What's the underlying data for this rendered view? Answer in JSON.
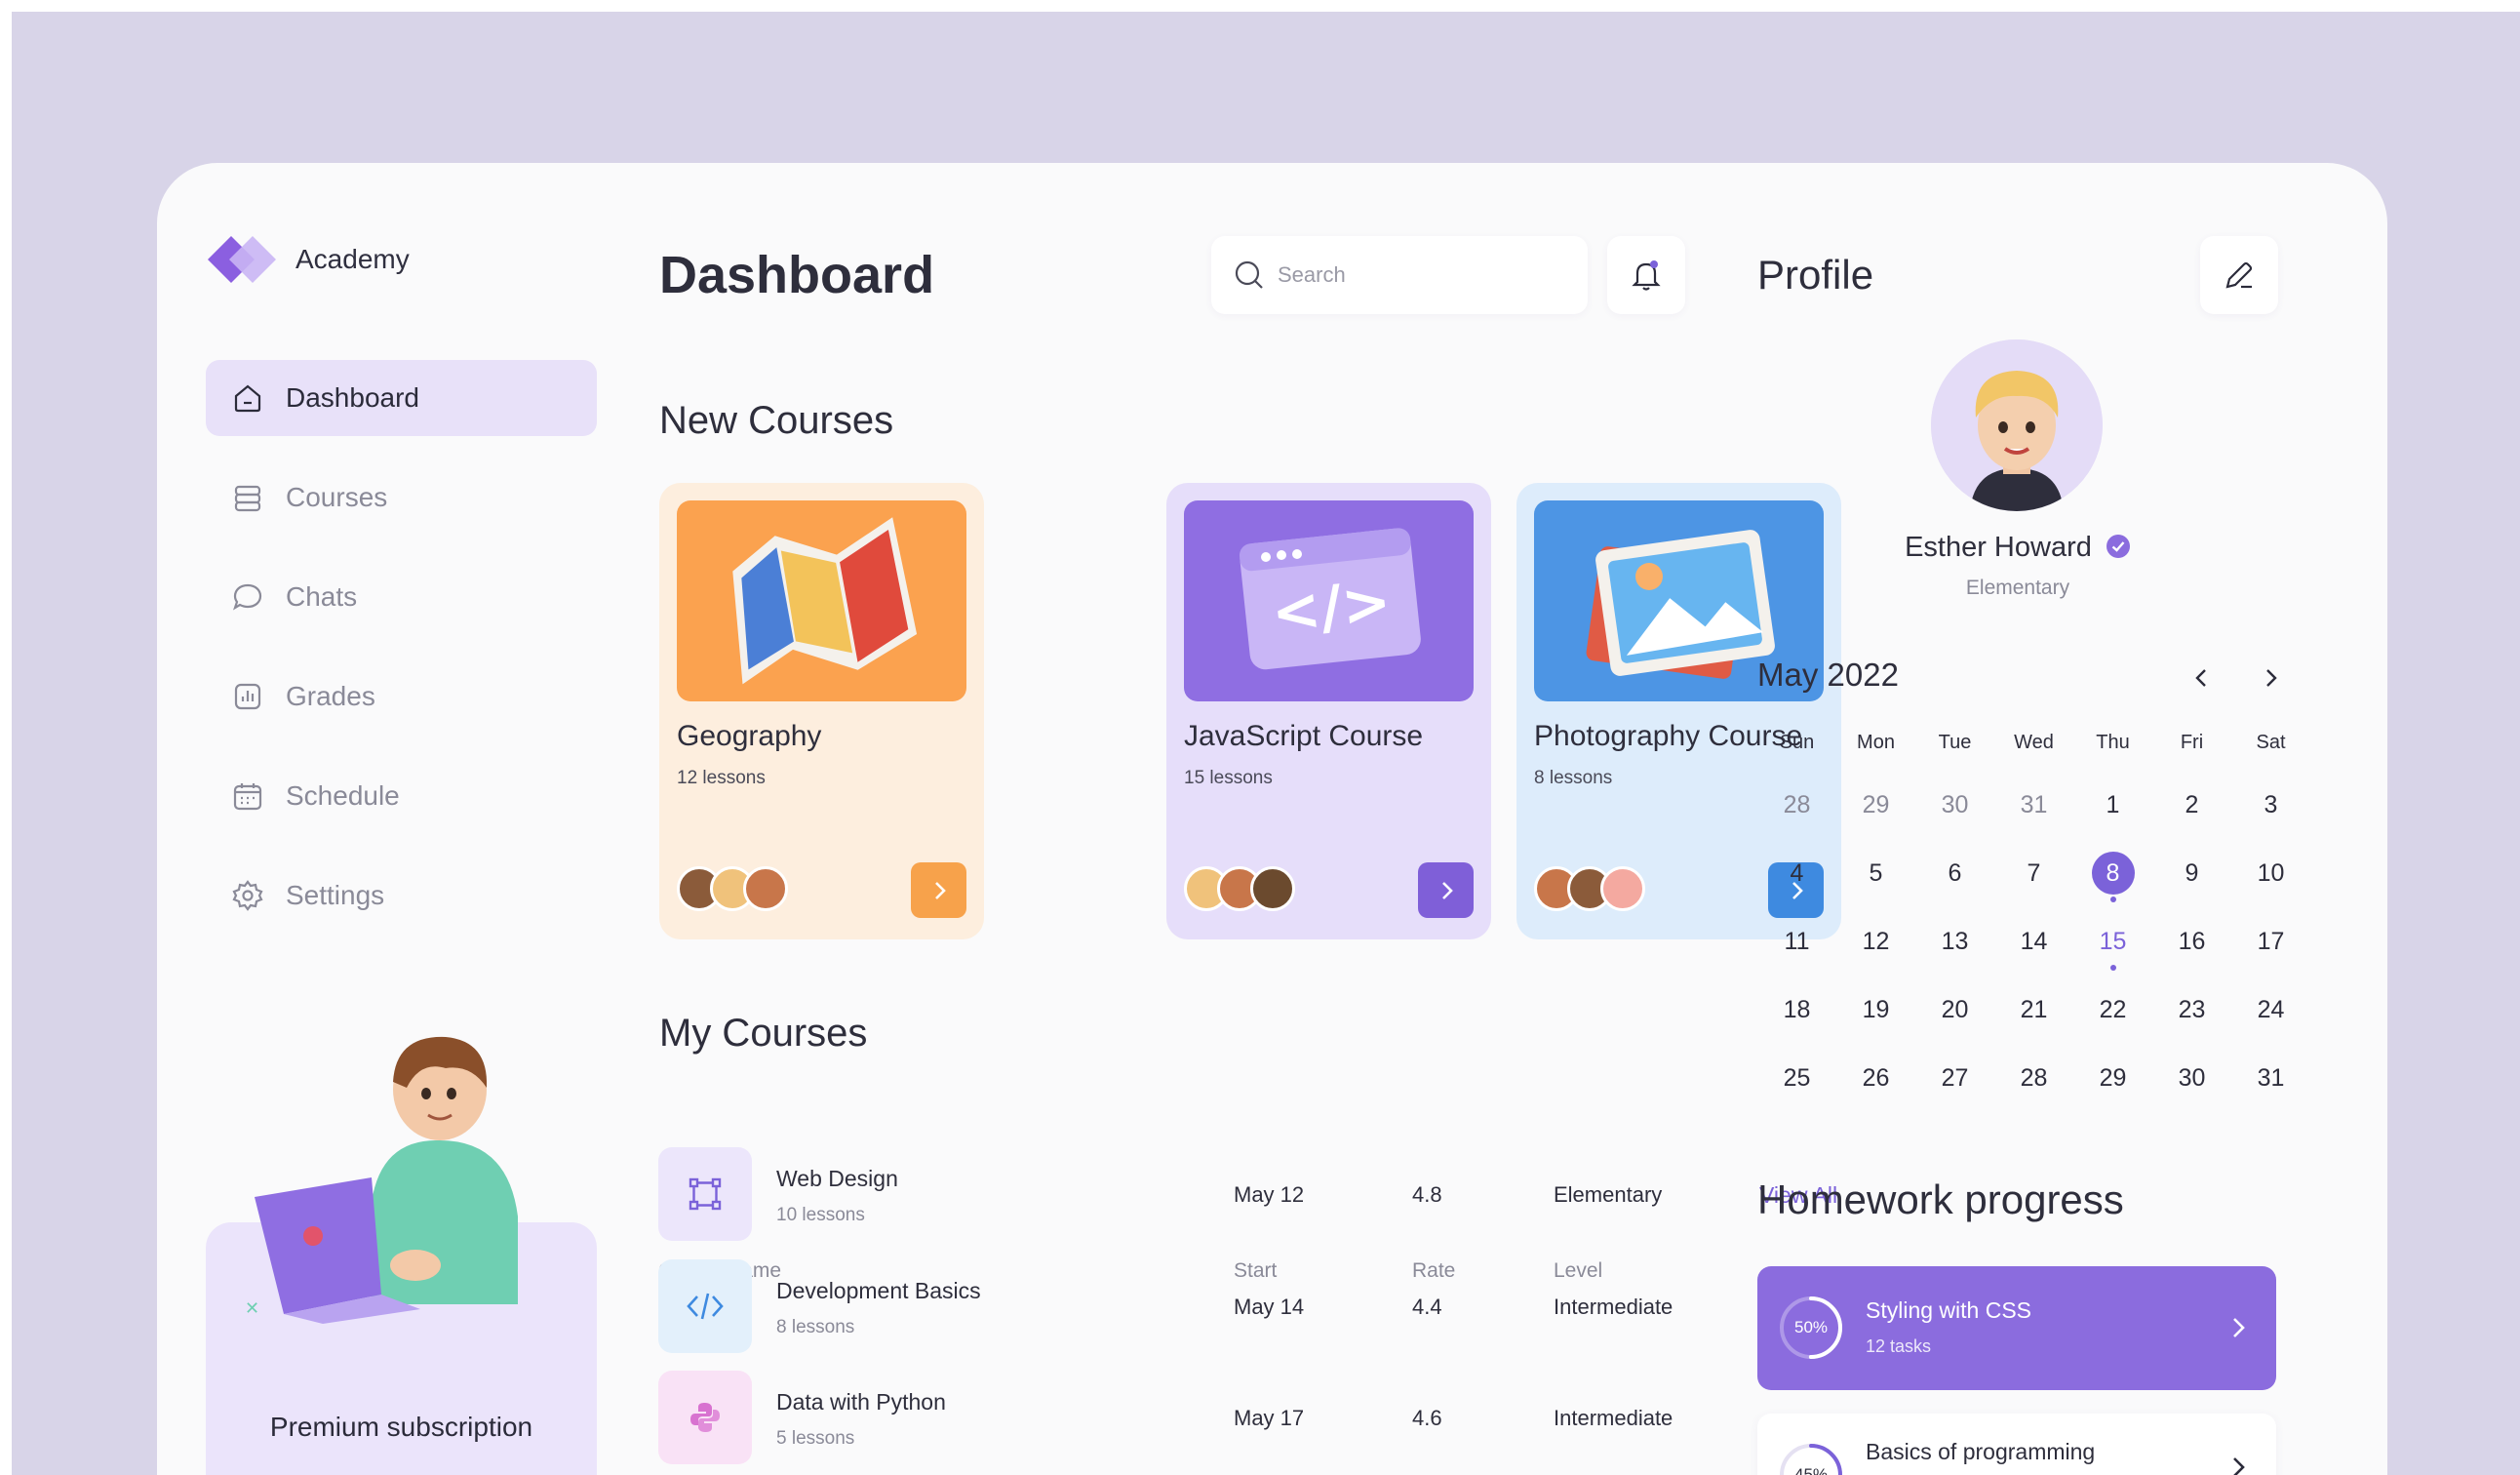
{
  "brand": {
    "name": "Academy"
  },
  "nav": [
    {
      "label": "Dashboard",
      "icon": "home-icon",
      "active": true
    },
    {
      "label": "Courses",
      "icon": "courses-icon",
      "active": false
    },
    {
      "label": "Chats",
      "icon": "chat-icon",
      "active": false
    },
    {
      "label": "Grades",
      "icon": "chart-icon",
      "active": false
    },
    {
      "label": "Schedule",
      "icon": "calendar-icon",
      "active": false
    },
    {
      "label": "Settings",
      "icon": "gear-icon",
      "active": false
    }
  ],
  "promo": {
    "title": "Premium subscription"
  },
  "header": {
    "title": "Dashboard",
    "search_placeholder": "Search"
  },
  "new_courses": {
    "title": "New Courses",
    "cards": [
      {
        "title": "Geography",
        "lessons": "12 lessons",
        "bg": "#fdeede",
        "thumb": "#fba24f",
        "button": "#f7a24b"
      },
      {
        "title": "JavaScript Course",
        "lessons": "15 lessons",
        "bg": "#e6defa",
        "thumb": "#8f6ee2",
        "button": "#7f5fd8"
      },
      {
        "title": "Photography Course",
        "lessons": "8 lessons",
        "bg": "#ddecfb",
        "thumb": "#4d95e4",
        "button": "#3e8ae0"
      }
    ]
  },
  "my_courses": {
    "title": "My Courses",
    "view_all": "View All",
    "columns": {
      "name": "Course name",
      "start": "Start",
      "rate": "Rate",
      "level": "Level"
    },
    "rows": [
      {
        "name": "Web Design",
        "lessons": "10 lessons",
        "start": "May 12",
        "rate": "4.8",
        "level": "Elementary",
        "icon": "vector-icon",
        "tint": "#ece6fb"
      },
      {
        "name": "Development Basics",
        "lessons": "8 lessons",
        "start": "May 14",
        "rate": "4.4",
        "level": "Intermediate",
        "icon": "code-icon",
        "tint": "#e3f0fb"
      },
      {
        "name": "Data with Python",
        "lessons": "5 lessons",
        "start": "May 17",
        "rate": "4.6",
        "level": "Intermediate",
        "icon": "python-icon",
        "tint": "#f9e2f6"
      }
    ]
  },
  "profile": {
    "title": "Profile",
    "name": "Esther Howard",
    "level": "Elementary"
  },
  "calendar": {
    "month": "May 2022",
    "weekdays": [
      "Sun",
      "Mon",
      "Tue",
      "Wed",
      "Thu",
      "Fri",
      "Sat"
    ],
    "weeks": [
      [
        "28",
        "29",
        "30",
        "31",
        "1",
        "2",
        "3"
      ],
      [
        "4",
        "5",
        "6",
        "7",
        "8",
        "9",
        "10"
      ],
      [
        "11",
        "12",
        "13",
        "14",
        "15",
        "16",
        "17"
      ],
      [
        "18",
        "19",
        "20",
        "21",
        "22",
        "23",
        "24"
      ],
      [
        "25",
        "26",
        "27",
        "28",
        "29",
        "30",
        "31"
      ]
    ],
    "selected": "8",
    "event_days": [
      "15"
    ]
  },
  "homework": {
    "title": "Homework progress",
    "items": [
      {
        "name": "Styling with CSS",
        "tasks": "12 tasks",
        "progress": 50,
        "progress_label": "50%"
      },
      {
        "name": "Basics of programming",
        "progress": 45,
        "progress_label": "45%"
      }
    ]
  },
  "colors": {
    "accent": "#7b62d9",
    "active_nav": "#e8e1f9",
    "backdrop": "#d8d4e8"
  }
}
